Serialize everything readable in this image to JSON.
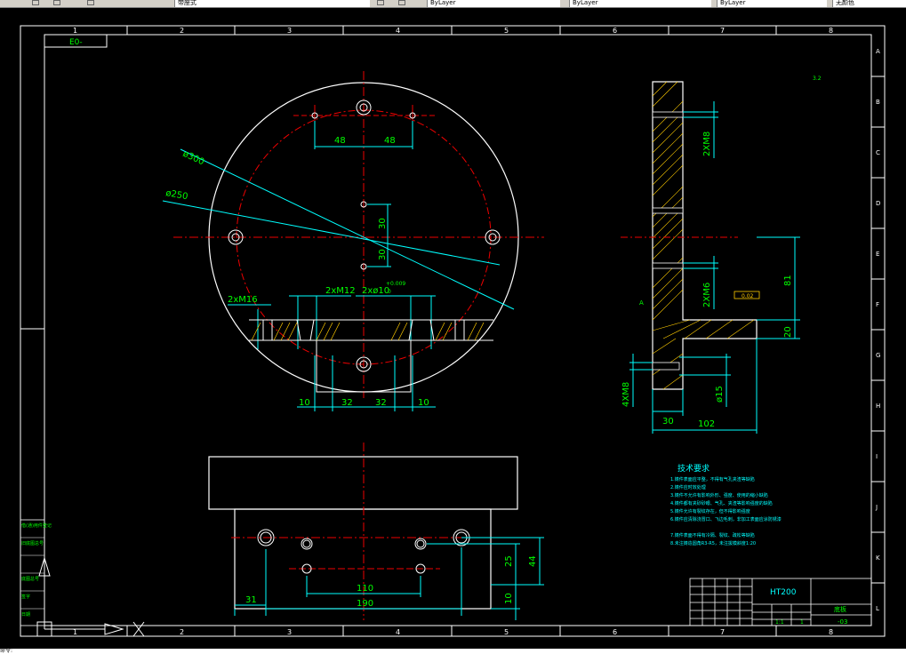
{
  "window": {
    "title_fragment": "带座式",
    "tab_a": "ByLayer",
    "tab_b": "ByLayer",
    "tab_c": "ByLayer",
    "tab_d": "无颜色"
  },
  "drawing": {
    "frame_label": "E0-",
    "col_numbers_top": [
      "1",
      "2",
      "3",
      "4",
      "5",
      "6",
      "7",
      "8"
    ],
    "col_numbers_bottom": [
      "1",
      "2",
      "3",
      "4",
      "5",
      "6",
      "7",
      "8"
    ],
    "row_letters": [
      "A",
      "B",
      "C",
      "D",
      "E",
      "F",
      "G",
      "H",
      "I",
      "J",
      "K",
      "L"
    ],
    "top_view": {
      "dia_300": "ø300",
      "dia_250": "ø250",
      "dim_48_left": "48",
      "dim_48_right": "48",
      "dim_30_up": "30",
      "dim_30_down": "30",
      "thread_m16": "2xM16",
      "thread_m12": "2xM12",
      "pin_hole": "2xø10",
      "pin_tol_upper": "+0.009",
      "pin_tol_lower": "0",
      "dim_10_left": "10",
      "dim_32_left": "32",
      "dim_32_right": "32",
      "dim_10_right": "10"
    },
    "side_view": {
      "thread_m8_top": "2XM8",
      "thread_m6": "2XM6",
      "thread_m8_bottom": "4XM8",
      "dim_81": "81",
      "dim_20": "20",
      "dim_30": "30",
      "dim_102": "102",
      "dim_15": "ø15",
      "roughness": "3.2",
      "tolerance_frame": "0.02",
      "datum": "A"
    },
    "front_view": {
      "dim_31": "31",
      "dim_110": "110",
      "dim_190": "190",
      "dim_25": "25",
      "dim_44": "44",
      "dim_10": "10"
    },
    "tech_requirements": {
      "title": "技术要求",
      "lines": [
        "1.铸件表面应平整，不得有气孔夹渣等缺陷",
        "2.铸件应时效处理",
        "3.铸件不允许有影响外形、强度、使用的缩小缺陷",
        "4.铸件都有夹砂砂眼、气孔、夹渣等影响强度的缺陷",
        "5.铸件允许有裂纹存在，但不得影响强度",
        "6.铸件应清除浇冒口、飞边毛刺，非加工表面应涂防锈漆",
        "7.铸件表面不得有冷隔、裂纹、疏松等缺陷",
        "8.未注铸造圆角R3-R5，未注拔模斜度1:20"
      ]
    },
    "title_block": {
      "material": "HT200",
      "part_name": "底板",
      "code": "-03",
      "scale": "1:1",
      "sheet": "1"
    },
    "left_labels": [
      "借(通)用件登记",
      "旧底图总号",
      "底图总号",
      "签字",
      "日期"
    ]
  },
  "command_line": "命令:"
}
